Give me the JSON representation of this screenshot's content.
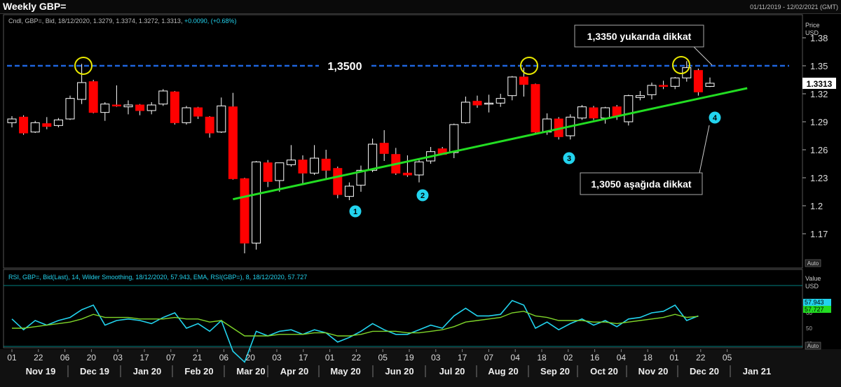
{
  "header": {
    "title": "Weekly GBP=",
    "date_range": "01/11/2019 - 12/02/2021 (GMT)"
  },
  "price_panel": {
    "legend": "Cndl, GBP=, Bid, 18/12/2020, 1.3279, 1.3374, 1.3272, 1.3313,",
    "legend_change": "+0.0090, (+0.68%)",
    "axis_title": "Price",
    "axis_unit": "USD",
    "last_price_label": "1.3313",
    "auto_label": "Auto",
    "resistance_label": "1,3500",
    "callout_top": "1,3350 yukarıda dikkat",
    "callout_bottom": "1,3050 aşağıda dikkat",
    "touch_markers": [
      "1",
      "2",
      "3",
      "4"
    ]
  },
  "rsi_panel": {
    "legend": "RSI, GBP=, Bid(Last),  14, Wilder Smoothing, 18/12/2020, 57.943, EMA, RSI(GBP=),  8, 18/12/2020, 57.727",
    "axis_title": "Value",
    "axis_unit": "USD",
    "rsi_badge": "57.943",
    "ema_badge": "57.727",
    "auto_label": "Auto"
  },
  "x_axis": {
    "day_labels": [
      "01",
      "22",
      "06",
      "20",
      "03",
      "17",
      "07",
      "21",
      "06",
      "20",
      "03",
      "17",
      "01",
      "22",
      "05",
      "19",
      "03",
      "17",
      "07",
      "04",
      "18",
      "02",
      "16",
      "04",
      "18",
      "01",
      "22",
      "05"
    ],
    "month_labels": [
      "Nov 19",
      "Dec 19",
      "Jan 20",
      "Feb 20",
      "Mar 20",
      "Apr 20",
      "May 20",
      "Jun 20",
      "Jul 20",
      "Aug 20",
      "Sep 20",
      "Oct 20",
      "Nov 20",
      "Dec 20",
      "Jan 21"
    ]
  },
  "colors": {
    "up": "#000000",
    "up_border": "#ffffff",
    "down": "#ff0000",
    "resistance": "#1e64dc",
    "trendline": "#22dd22",
    "marker": "#22d3ee",
    "circle": "#e8e800",
    "rsi": "#22d3ee",
    "ema": "#7fd62a"
  },
  "chart_data": [
    {
      "type": "candlestick",
      "title": "Weekly GBP=",
      "ylabel": "Price USD",
      "ylim": [
        1.14,
        1.4
      ],
      "yticks": [
        1.17,
        1.2,
        1.23,
        1.26,
        1.29,
        1.32,
        1.35,
        1.38
      ],
      "ohlc": [
        [
          1.289,
          1.296,
          1.284,
          1.293
        ],
        [
          1.295,
          1.297,
          1.276,
          1.278
        ],
        [
          1.279,
          1.291,
          1.278,
          1.289
        ],
        [
          1.288,
          1.295,
          1.282,
          1.285
        ],
        [
          1.286,
          1.294,
          1.284,
          1.292
        ],
        [
          1.293,
          1.318,
          1.292,
          1.315
        ],
        [
          1.314,
          1.352,
          1.309,
          1.332
        ],
        [
          1.333,
          1.335,
          1.299,
          1.3
        ],
        [
          1.3,
          1.311,
          1.291,
          1.309
        ],
        [
          1.308,
          1.329,
          1.306,
          1.307
        ],
        [
          1.306,
          1.313,
          1.298,
          1.308
        ],
        [
          1.308,
          1.309,
          1.297,
          1.302
        ],
        [
          1.302,
          1.311,
          1.298,
          1.308
        ],
        [
          1.309,
          1.325,
          1.307,
          1.323
        ],
        [
          1.322,
          1.323,
          1.287,
          1.289
        ],
        [
          1.289,
          1.307,
          1.287,
          1.305
        ],
        [
          1.305,
          1.306,
          1.293,
          1.296
        ],
        [
          1.295,
          1.296,
          1.273,
          1.278
        ],
        [
          1.279,
          1.316,
          1.278,
          1.307
        ],
        [
          1.306,
          1.321,
          1.228,
          1.229
        ],
        [
          1.229,
          1.23,
          1.149,
          1.16
        ],
        [
          1.16,
          1.248,
          1.153,
          1.247
        ],
        [
          1.246,
          1.249,
          1.22,
          1.226
        ],
        [
          1.227,
          1.246,
          1.215,
          1.246
        ],
        [
          1.244,
          1.265,
          1.242,
          1.249
        ],
        [
          1.249,
          1.254,
          1.224,
          1.235
        ],
        [
          1.235,
          1.265,
          1.233,
          1.251
        ],
        [
          1.25,
          1.26,
          1.229,
          1.238
        ],
        [
          1.24,
          1.242,
          1.208,
          1.212
        ],
        [
          1.21,
          1.225,
          1.206,
          1.221
        ],
        [
          1.222,
          1.243,
          1.215,
          1.238
        ],
        [
          1.238,
          1.272,
          1.236,
          1.266
        ],
        [
          1.267,
          1.281,
          1.248,
          1.256
        ],
        [
          1.255,
          1.262,
          1.233,
          1.235
        ],
        [
          1.235,
          1.254,
          1.231,
          1.233
        ],
        [
          1.233,
          1.25,
          1.225,
          1.247
        ],
        [
          1.248,
          1.263,
          1.245,
          1.258
        ],
        [
          1.261,
          1.263,
          1.255,
          1.255
        ],
        [
          1.257,
          1.288,
          1.251,
          1.287
        ],
        [
          1.289,
          1.317,
          1.288,
          1.311
        ],
        [
          1.312,
          1.318,
          1.305,
          1.308
        ],
        [
          1.309,
          1.319,
          1.3,
          1.31
        ],
        [
          1.31,
          1.32,
          1.306,
          1.315
        ],
        [
          1.318,
          1.339,
          1.313,
          1.338
        ],
        [
          1.338,
          1.348,
          1.317,
          1.33
        ],
        [
          1.33,
          1.331,
          1.277,
          1.279
        ],
        [
          1.279,
          1.299,
          1.276,
          1.293
        ],
        [
          1.293,
          1.295,
          1.271,
          1.274
        ],
        [
          1.275,
          1.298,
          1.271,
          1.295
        ],
        [
          1.294,
          1.308,
          1.292,
          1.306
        ],
        [
          1.305,
          1.307,
          1.292,
          1.294
        ],
        [
          1.294,
          1.306,
          1.288,
          1.305
        ],
        [
          1.306,
          1.308,
          1.292,
          1.296
        ],
        [
          1.29,
          1.319,
          1.286,
          1.318
        ],
        [
          1.316,
          1.323,
          1.313,
          1.318
        ],
        [
          1.319,
          1.332,
          1.314,
          1.329
        ],
        [
          1.329,
          1.334,
          1.325,
          1.328
        ],
        [
          1.328,
          1.338,
          1.325,
          1.337
        ],
        [
          1.337,
          1.355,
          1.333,
          1.348
        ],
        [
          1.345,
          1.347,
          1.318,
          1.322
        ],
        [
          1.3279,
          1.3374,
          1.3272,
          1.3313
        ]
      ],
      "resistance": 1.35,
      "trendline": {
        "from": {
          "week": 19,
          "price": 1.207
        },
        "to": {
          "week": 62,
          "price": 1.326
        }
      }
    },
    {
      "type": "line",
      "title": "RSI, GBP=, Bid(Last), 14, Wilder Smoothing",
      "ylabel": "Value USD",
      "ylim": [
        25,
        77
      ],
      "yticks": [
        40,
        50,
        60
      ],
      "series": [
        {
          "name": "RSI",
          "values": [
            56,
            49,
            55,
            52,
            55,
            57,
            62,
            65,
            52,
            55,
            56,
            55,
            53,
            57,
            60,
            50,
            53,
            48,
            55,
            35,
            28,
            48,
            45,
            48,
            49,
            46,
            49,
            47,
            41,
            44,
            48,
            53,
            49,
            46,
            46,
            49,
            52,
            50,
            58,
            63,
            58,
            58,
            59,
            68,
            65,
            50,
            54,
            49,
            53,
            56,
            52,
            55,
            51,
            56,
            57,
            60,
            61,
            65,
            55,
            58
          ]
        },
        {
          "name": "EMA",
          "values": [
            50,
            50,
            51,
            52,
            53,
            54,
            56,
            59,
            57,
            57,
            57,
            56,
            56,
            56,
            57,
            56,
            56,
            54,
            55,
            50,
            45,
            45,
            45,
            46,
            46,
            46,
            47,
            47,
            45,
            45,
            46,
            48,
            48,
            48,
            47,
            47,
            48,
            49,
            51,
            54,
            55,
            56,
            57,
            60,
            61,
            58,
            57,
            55,
            55,
            55,
            54,
            54,
            53,
            54,
            55,
            56,
            57,
            59,
            57,
            57.7
          ]
        }
      ]
    }
  ]
}
